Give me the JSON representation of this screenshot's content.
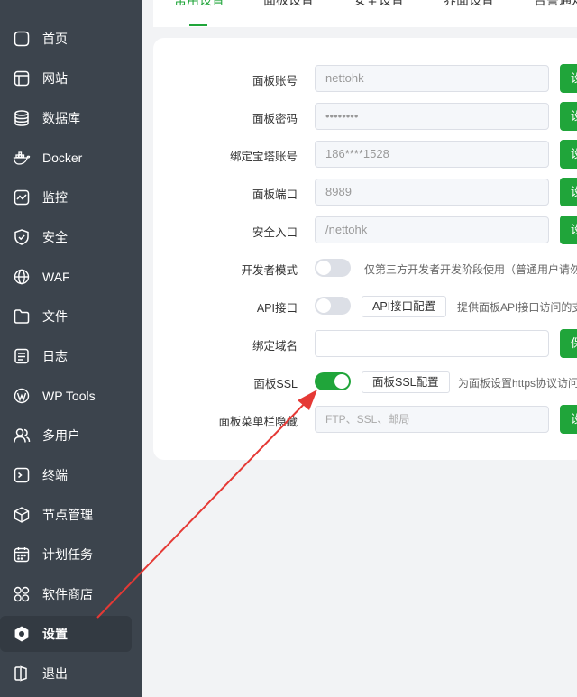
{
  "sidebar": {
    "items": [
      {
        "label": "首页",
        "icon": "home-icon"
      },
      {
        "label": "网站",
        "icon": "website-icon"
      },
      {
        "label": "数据库",
        "icon": "database-icon"
      },
      {
        "label": "Docker",
        "icon": "docker-icon"
      },
      {
        "label": "监控",
        "icon": "monitor-icon"
      },
      {
        "label": "安全",
        "icon": "shield-icon"
      },
      {
        "label": "WAF",
        "icon": "waf-icon"
      },
      {
        "label": "文件",
        "icon": "folder-icon"
      },
      {
        "label": "日志",
        "icon": "log-icon"
      },
      {
        "label": "WP Tools",
        "icon": "wordpress-icon"
      },
      {
        "label": "多用户",
        "icon": "users-icon"
      },
      {
        "label": "终端",
        "icon": "terminal-icon"
      },
      {
        "label": "节点管理",
        "icon": "node-icon"
      },
      {
        "label": "计划任务",
        "icon": "calendar-icon"
      },
      {
        "label": "软件商店",
        "icon": "store-icon"
      },
      {
        "label": "设置",
        "icon": "settings-icon"
      },
      {
        "label": "退出",
        "icon": "logout-icon"
      }
    ]
  },
  "tabs": [
    "常用设置",
    "面板设置",
    "安全设置",
    "界面设置",
    "告警通知"
  ],
  "settings": {
    "account_label": "面板账号",
    "account_value": "nettohk",
    "password_label": "面板密码",
    "password_value": "••••••••",
    "bind_label": "绑定宝塔账号",
    "bind_value": "186****1528",
    "port_label": "面板端口",
    "port_value": "8989",
    "entry_label": "安全入口",
    "entry_value": "/nettohk",
    "dev_label": "开发者模式",
    "dev_desc": "仅第三方开发者开发阶段使用（普通用户请勿",
    "api_label": "API接口",
    "api_button": "API接口配置",
    "api_desc": "提供面板API接口访问的支",
    "domain_label": "绑定域名",
    "ssl_label": "面板SSL",
    "ssl_button": "面板SSL配置",
    "ssl_desc": "为面板设置https协议访问",
    "menu_hide_label": "面板菜单栏隐藏",
    "menu_hide_placeholder": "FTP、SSL、邮局",
    "set_button": "设",
    "save_button": "保"
  },
  "colors": {
    "sidebar_bg": "#3c444d",
    "accent": "#20a53a",
    "arrow": "#e53935"
  }
}
